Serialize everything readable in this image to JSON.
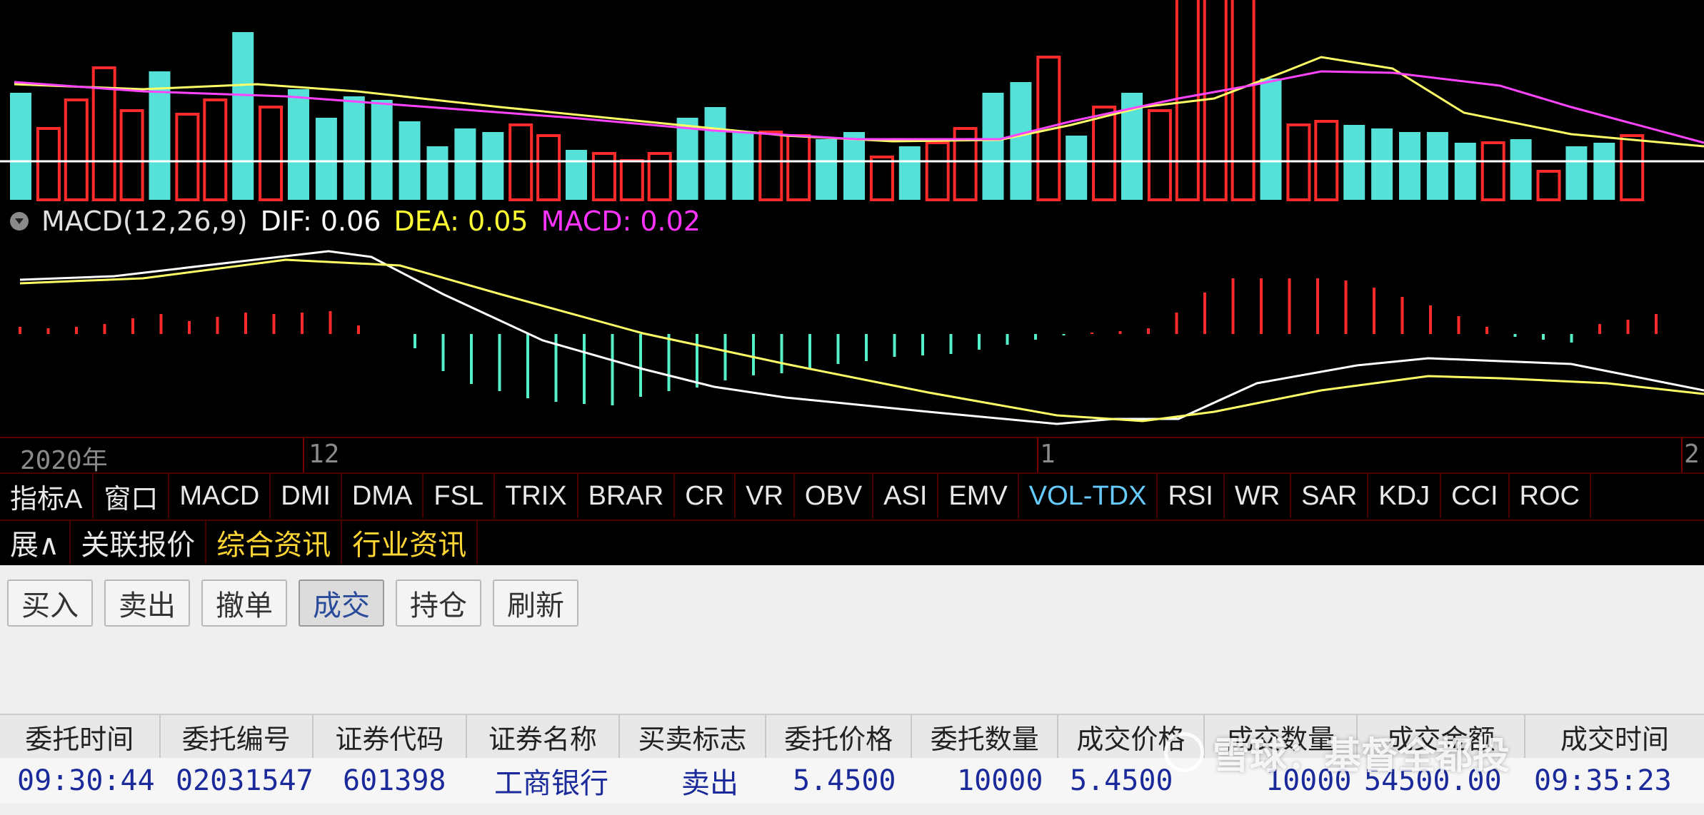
{
  "indicator_header": {
    "name": "MACD(12,26,9)",
    "dif_label": "DIF: 0.06",
    "dea_label": "DEA: 0.05",
    "macd_label": "MACD: 0.02"
  },
  "axis": {
    "year_label": "2020年",
    "label_12": "12",
    "label_1": "1",
    "label_2": "2"
  },
  "indicator_tabs": [
    {
      "label": "指标A"
    },
    {
      "label": "窗口"
    },
    {
      "label": "MACD"
    },
    {
      "label": "DMI"
    },
    {
      "label": "DMA"
    },
    {
      "label": "FSL"
    },
    {
      "label": "TRIX"
    },
    {
      "label": "BRAR"
    },
    {
      "label": "CR"
    },
    {
      "label": "VR"
    },
    {
      "label": "OBV"
    },
    {
      "label": "ASI"
    },
    {
      "label": "EMV"
    },
    {
      "label": "VOL-TDX"
    },
    {
      "label": "RSI"
    },
    {
      "label": "WR"
    },
    {
      "label": "SAR"
    },
    {
      "label": "KDJ"
    },
    {
      "label": "CCI"
    },
    {
      "label": "ROC"
    }
  ],
  "sub_tabs": [
    {
      "label": "展∧"
    },
    {
      "label": "关联报价"
    },
    {
      "label": "综合资讯"
    },
    {
      "label": "行业资讯"
    }
  ],
  "trade_buttons": [
    {
      "label": "买入"
    },
    {
      "label": "卖出"
    },
    {
      "label": "撤单"
    },
    {
      "label": "成交"
    },
    {
      "label": "持仓"
    },
    {
      "label": "刷新"
    }
  ],
  "table": {
    "headers": [
      "委托时间",
      "委托编号",
      "证券代码",
      "证券名称",
      "买卖标志",
      "委托价格",
      "委托数量",
      "成交价格",
      "成交数量",
      "成交金额",
      "成交时间"
    ],
    "rows": [
      [
        "09:30:44",
        "02031547",
        "601398",
        "工商银行",
        "卖出",
        "5.4500",
        "10000",
        "5.4500",
        "10000",
        "54500.00",
        "09:35:23"
      ]
    ]
  },
  "watermark": {
    "text": "雪球：基督全都投"
  },
  "colors": {
    "background": "#000000",
    "bar_up": "#ff2a2a",
    "bar_down": "#55e0d8",
    "line_white": "#ffffff",
    "line_yellow": "#ffff66",
    "line_magenta": "#ff44ff",
    "dif_text": "#ffffff",
    "dea_text": "#ffff33",
    "macd_text": "#ff33ff",
    "table_text": "#1a2a9a"
  },
  "icons": {
    "indicator_toggle": "chevron-down-icon",
    "watermark_logo": "snowball-logo-icon"
  }
}
